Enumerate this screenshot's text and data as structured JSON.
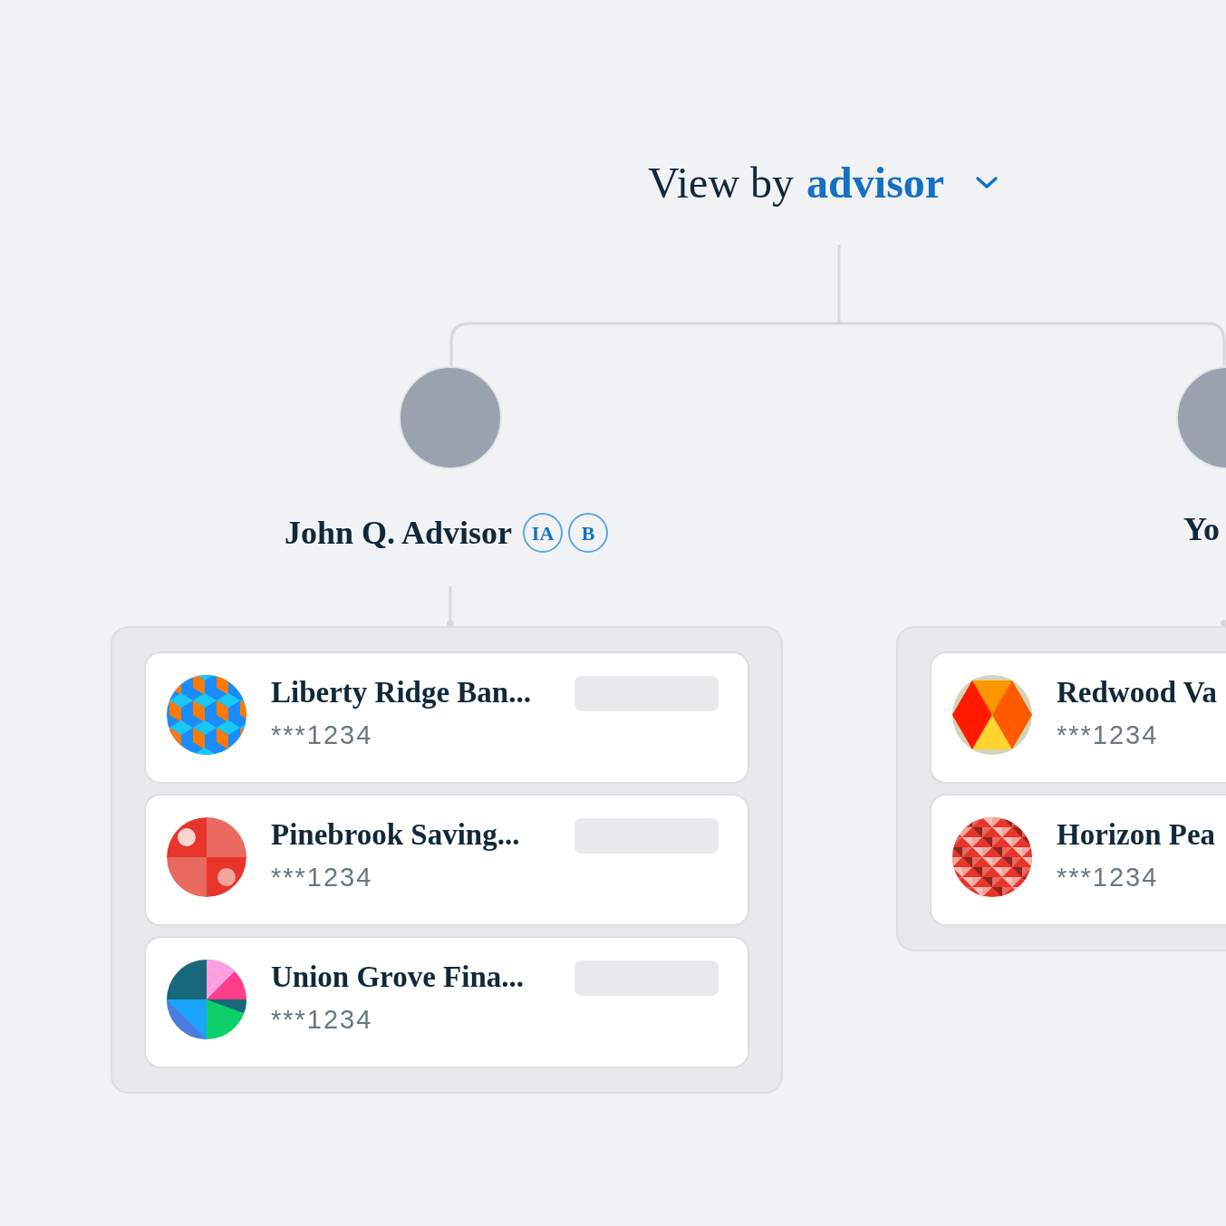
{
  "heading": {
    "prefix": "View by",
    "value": "advisor"
  },
  "advisors": [
    {
      "name": "John Q. Advisor",
      "badges": [
        "IA",
        "B"
      ],
      "accounts": [
        {
          "name": "Liberty Ridge Ban...",
          "number": "***1234",
          "kind": "cubes"
        },
        {
          "name": "Pinebrook Saving...",
          "number": "***1234",
          "kind": "petals"
        },
        {
          "name": "Union Grove Fina...",
          "number": "***1234",
          "kind": "quarters"
        }
      ]
    },
    {
      "name": "Yo",
      "accounts": [
        {
          "name": "Redwood Va",
          "number": "***1234",
          "kind": "hexagon"
        },
        {
          "name": "Horizon Pea",
          "number": "***1234",
          "kind": "triangles"
        }
      ]
    }
  ]
}
